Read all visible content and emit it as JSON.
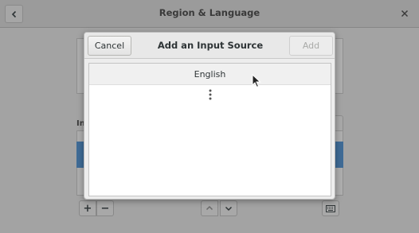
{
  "window": {
    "title": "Region & Language",
    "back_icon": "chevron-left-icon",
    "close_icon": "close-icon",
    "input_sources_label_partial": "In"
  },
  "toolbar": {
    "add_label": "+",
    "remove_label": "−",
    "up_icon": "chevron-up-icon",
    "down_icon": "chevron-down-icon",
    "keyboard_icon": "keyboard-icon"
  },
  "dialog": {
    "title": "Add an Input Source",
    "cancel_label": "Cancel",
    "add_label": "Add",
    "add_enabled": false,
    "items": [
      {
        "label": "English"
      }
    ],
    "more_icon": "view-more-vertical-icon"
  },
  "colors": {
    "selection": "#3f6b96",
    "dim_overlay": "#a3a3a3"
  }
}
